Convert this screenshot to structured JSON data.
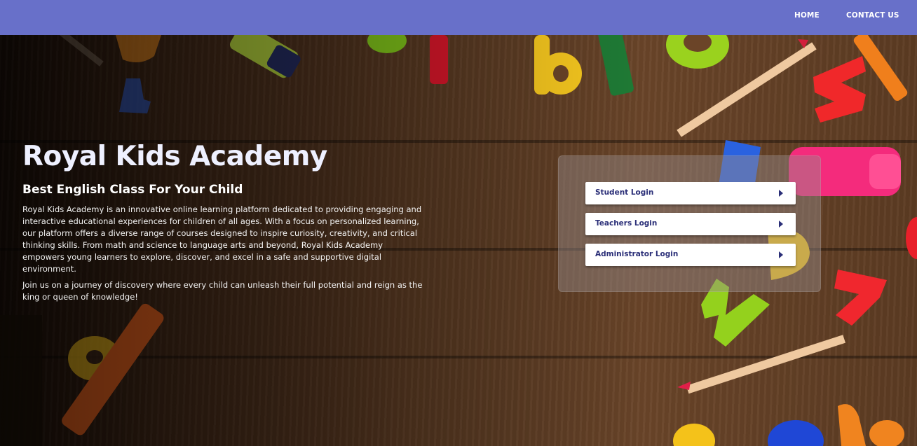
{
  "nav": {
    "home_label": "HOME",
    "contact_label": "CONTACT US",
    "bar_color": "#6870c9"
  },
  "hero": {
    "title": "Royal Kids Academy",
    "subtitle": "Best English Class For Your Child",
    "description": "Royal Kids Academy is an innovative online learning platform dedicated to providing engaging and interactive educational experiences for children of all ages. With a focus on personalized learning, our platform offers a diverse range of courses designed to inspire curiosity, creativity, and critical thinking skills. From math and science to language arts and beyond, Royal Kids Academy empowers young learners to explore, discover, and excel in a safe and supportive digital environment.",
    "description2": "Join us on a journey of discovery where every child can unleash their full potential and reign as the king or queen of knowledge!"
  },
  "login": {
    "student_label": "Student Login",
    "teacher_label": "Teachers Login",
    "admin_label": "Administrator Login",
    "text_color": "#2b2f78"
  },
  "icons": {
    "login_arrow": "caret-right-icon"
  }
}
